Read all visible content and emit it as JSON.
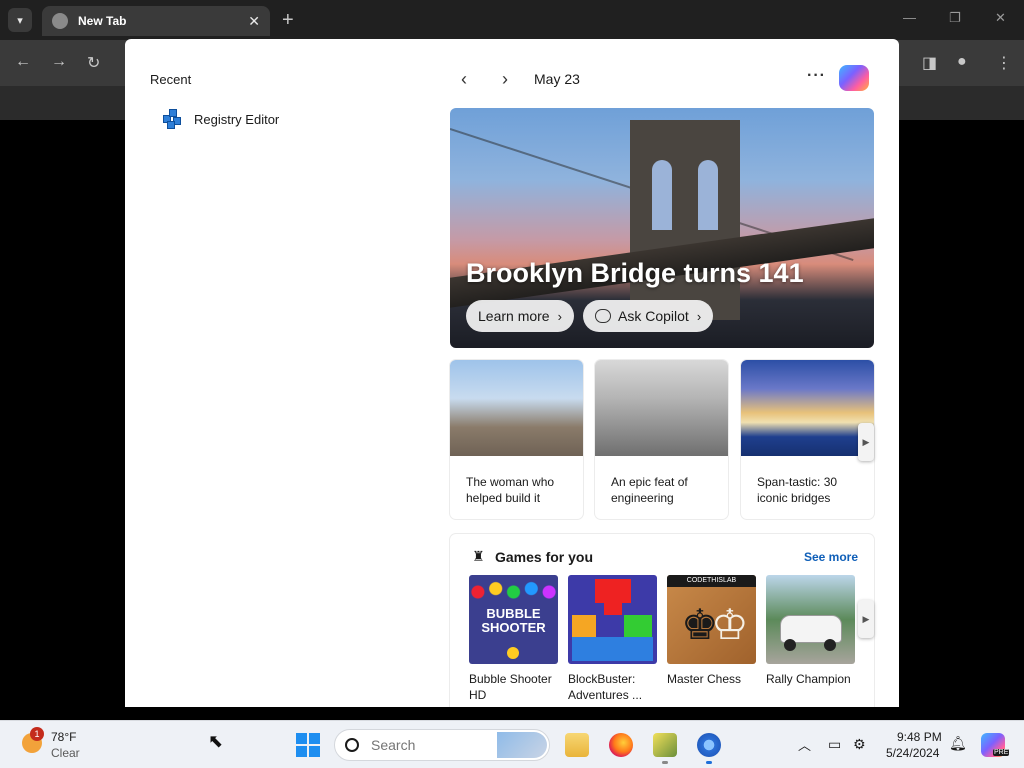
{
  "browser": {
    "tab_title": "New Tab"
  },
  "start": {
    "recent_title": "Recent",
    "recent_items": [
      {
        "label": "Registry Editor",
        "icon": "registry-editor-icon"
      }
    ],
    "date": "May 23",
    "hero": {
      "title": "Brooklyn Bridge turns 141",
      "learn_more": "Learn more",
      "ask_copilot": "Ask Copilot"
    },
    "cards": [
      {
        "text": "The woman who helped build it"
      },
      {
        "text": "An epic feat of engineering"
      },
      {
        "text": "Span-tastic: 30 iconic bridges"
      }
    ],
    "games": {
      "title": "Games for you",
      "see_more": "See more",
      "items": [
        {
          "name": "Bubble Shooter HD",
          "art_text": "BUBBLE SHOOTER"
        },
        {
          "name": "BlockBuster: Adventures ...",
          "art_text": ""
        },
        {
          "name": "Master Chess",
          "art_text": "CODETHISLAB"
        },
        {
          "name": "Rally Champion",
          "art_text": ""
        }
      ]
    }
  },
  "taskbar": {
    "weather_temp": "78°F",
    "weather_cond": "Clear",
    "weather_badge": "1",
    "search_placeholder": "Search",
    "time": "9:48 PM",
    "date": "5/24/2024",
    "copilot_badge": "PRE"
  },
  "colors": {
    "accent": "#1e8ef0",
    "link": "#0f5fb8",
    "taskbar_bg": "#eef1f6"
  }
}
